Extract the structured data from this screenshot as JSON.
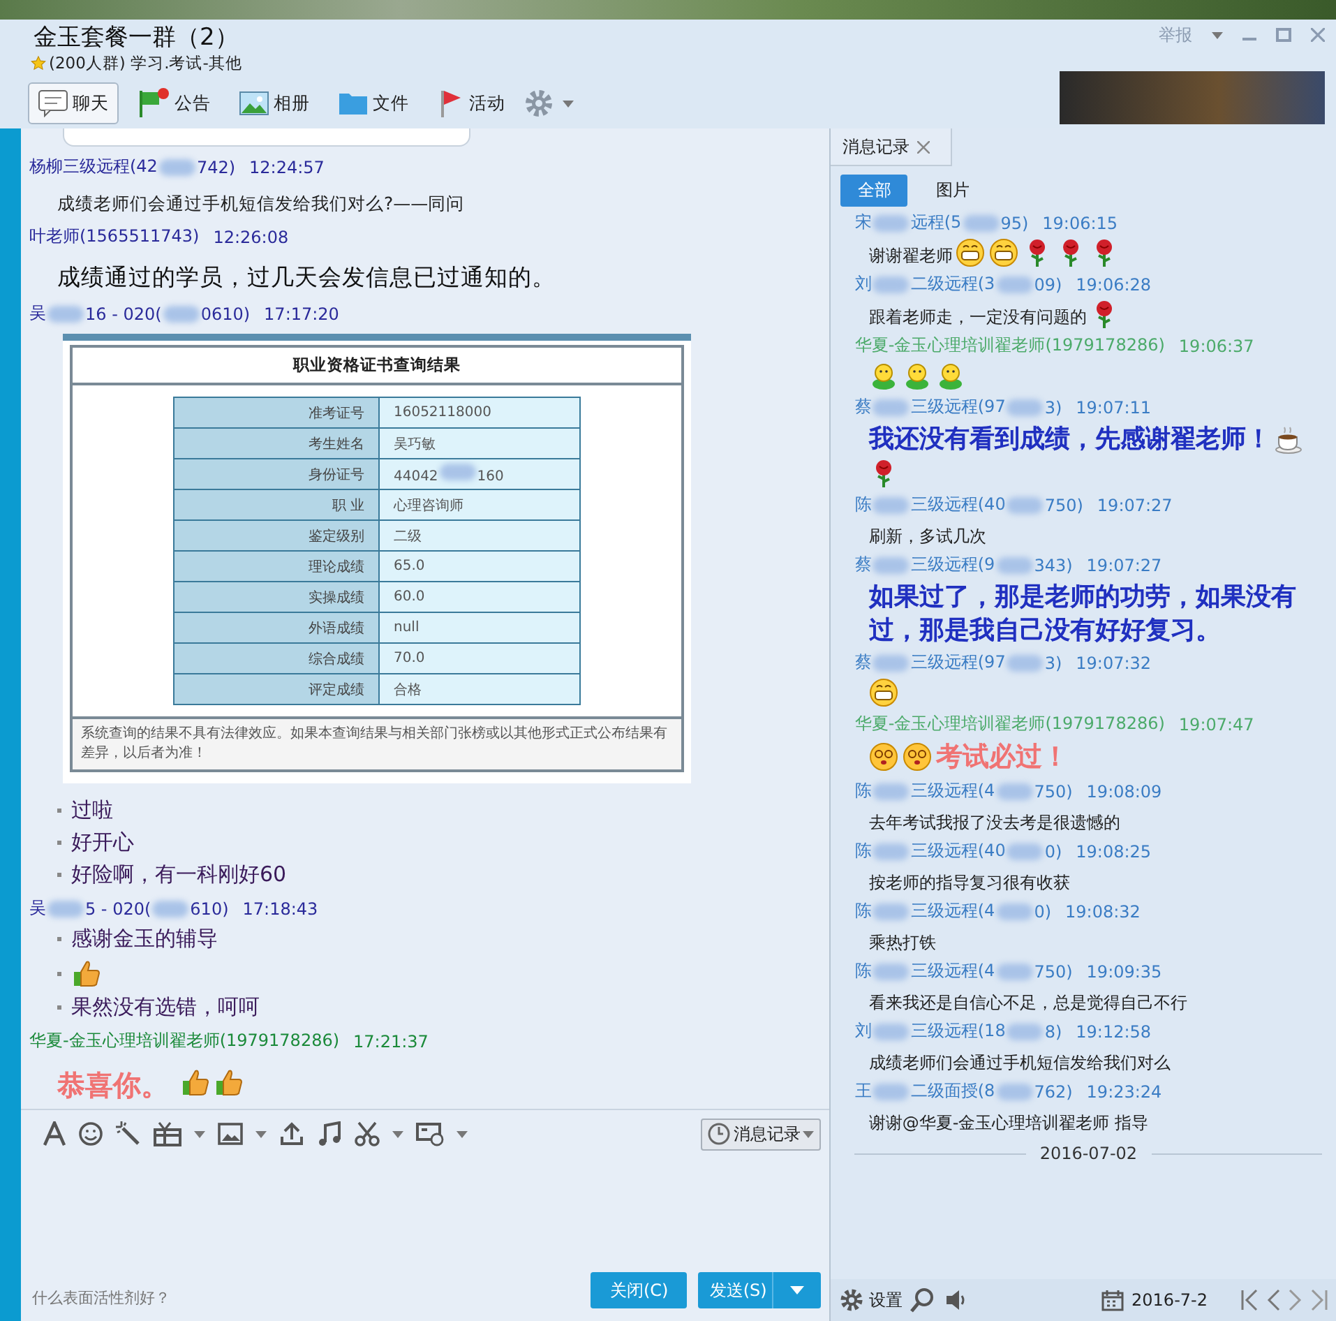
{
  "window": {
    "title": "金玉套餐一群（2）",
    "subtitle": "(200人群) 学习.考试-其他",
    "report": "举报"
  },
  "tabs": [
    {
      "label": "聊天",
      "kind": "chat",
      "selected": true
    },
    {
      "label": "公告",
      "kind": "notice",
      "selected": false
    },
    {
      "label": "相册",
      "kind": "album",
      "selected": false
    },
    {
      "label": "文件",
      "kind": "file",
      "selected": false
    },
    {
      "label": "活动",
      "kind": "event",
      "selected": false
    }
  ],
  "chat": {
    "messages": [
      {
        "sender": [
          "杨柳三级远程(42",
          "742)"
        ],
        "color": "#2a2a9a",
        "time": "12:24:57",
        "kind": "plain",
        "lines": [
          [
            {
              "kind": "text",
              "text": "成绩老师们会通过手机短信发给我们对么?——同问"
            }
          ]
        ]
      },
      {
        "sender": [
          "叶老师(1565511743)"
        ],
        "color": "#2a2a9a",
        "time": "12:26:08",
        "kind": "large",
        "lines": [
          [
            {
              "kind": "text",
              "text": "成绩通过的学员，过几天会发信息已过通知的。"
            }
          ]
        ]
      },
      {
        "sender": [
          "吴",
          "16 - 020(",
          "0610)"
        ],
        "color": "#2a2a9a",
        "time": "17:17:20",
        "kind": "bullet",
        "certificate": {
          "title": "职业资格证书查询结果",
          "rows": [
            {
              "label": "准考证号",
              "value": [
                "16052118000"
              ]
            },
            {
              "label": "考生姓名",
              "value": [
                "吴巧敏"
              ]
            },
            {
              "label": "身份证号",
              "value": [
                "44042",
                "160"
              ]
            },
            {
              "label": "职 业",
              "value": [
                "心理咨询师"
              ]
            },
            {
              "label": "鉴定级别",
              "value": [
                "二级"
              ]
            },
            {
              "label": "理论成绩",
              "value": [
                "65.0"
              ]
            },
            {
              "label": "实操成绩",
              "value": [
                "60.0"
              ]
            },
            {
              "label": "外语成绩",
              "value": [
                "null"
              ]
            },
            {
              "label": "综合成绩",
              "value": [
                "70.0"
              ]
            },
            {
              "label": "评定成绩",
              "value": [
                "合格"
              ]
            }
          ],
          "notice": "系统查询的结果不具有法律效应。如果本查询结果与相关部门张榜或以其他形式正式公布结果有差异，以后者为准！"
        },
        "lines": [
          [
            {
              "kind": "text",
              "text": "过啦"
            }
          ],
          [
            {
              "kind": "text",
              "text": "好开心"
            }
          ],
          [
            {
              "kind": "text",
              "text": "好险啊，有一科刚好60"
            }
          ]
        ]
      },
      {
        "sender": [
          "吴",
          "5 - 020(",
          "610)"
        ],
        "color": "#2a2a9a",
        "time": "17:18:43",
        "kind": "bullet",
        "lines": [
          [
            {
              "kind": "text",
              "text": "感谢金玉的辅导"
            }
          ],
          [
            {
              "kind": "thumb"
            }
          ],
          [
            {
              "kind": "text",
              "text": "果然没有选错，呵呵"
            }
          ]
        ]
      },
      {
        "sender": [
          "华夏-金玉心理培训翟老师(1979178286)"
        ],
        "color": "#1b8a3a",
        "time": "17:21:37",
        "kind": "pink",
        "lines": [
          [
            {
              "kind": "text",
              "text": "恭喜你。"
            },
            {
              "kind": "thumb"
            },
            {
              "kind": "thumb"
            }
          ]
        ]
      }
    ],
    "history_button": "消息记录",
    "hint": "什么表面活性剂好？",
    "close_button": "关闭(C)",
    "send_button": "发送(S)"
  },
  "history": {
    "tab": "消息记录",
    "filters": [
      {
        "label": "全部",
        "selected": true
      },
      {
        "label": "图片",
        "selected": false
      }
    ],
    "messages": [
      {
        "sender": [
          "宋",
          "远程(5",
          "95)"
        ],
        "color": "#3a7cc4",
        "time": "19:06:15",
        "kind": "plain",
        "segments": [
          {
            "kind": "text",
            "text": "谢谢翟老师"
          },
          {
            "kind": "grin"
          },
          {
            "kind": "grin"
          },
          {
            "kind": "rose"
          },
          {
            "kind": "rose"
          },
          {
            "kind": "rose"
          }
        ]
      },
      {
        "sender": [
          "刘",
          "二级远程(3",
          "09)"
        ],
        "color": "#3a7cc4",
        "time": "19:06:28",
        "kind": "plain",
        "segments": [
          {
            "kind": "text",
            "text": "跟着老师走，一定没有问题的"
          },
          {
            "kind": "rose"
          }
        ]
      },
      {
        "sender": [
          "华夏-金玉心理培训翟老师(1979178286)"
        ],
        "color": "#4caa6a",
        "time": "19:06:37",
        "kind": "plain",
        "segments": [
          {
            "kind": "figure"
          },
          {
            "kind": "figure"
          },
          {
            "kind": "figure"
          }
        ]
      },
      {
        "sender": [
          "蔡",
          "三级远程(97",
          "3)"
        ],
        "color": "#3a7cc4",
        "time": "19:07:11",
        "kind": "blue",
        "segments": [
          {
            "kind": "text",
            "text": "我还没有看到成绩，先感谢翟老师！"
          },
          {
            "kind": "coffee"
          },
          {
            "kind": "rose"
          }
        ]
      },
      {
        "sender": [
          "陈",
          "三级远程(40",
          "750)"
        ],
        "color": "#3a7cc4",
        "time": "19:07:27",
        "kind": "plain",
        "segments": [
          {
            "kind": "text",
            "text": "刷新，多试几次"
          }
        ]
      },
      {
        "sender": [
          "蔡",
          "三级远程(9",
          "343)"
        ],
        "color": "#3a7cc4",
        "time": "19:07:27",
        "kind": "blue",
        "segments": [
          {
            "kind": "text",
            "text": "如果过了，那是老师的功劳，如果没有过，那是我自己没有好好复习。"
          }
        ]
      },
      {
        "sender": [
          "蔡",
          "三级远程(97",
          "3)"
        ],
        "color": "#3a7cc4",
        "time": "19:07:32",
        "kind": "plain",
        "segments": [
          {
            "kind": "grin"
          }
        ]
      },
      {
        "sender": [
          "华夏-金玉心理培训翟老师(1979178286)"
        ],
        "color": "#4caa6a",
        "time": "19:07:47",
        "kind": "pink",
        "segments": [
          {
            "kind": "dizzy"
          },
          {
            "kind": "dizzy"
          },
          {
            "kind": "text",
            "text": "考试必过！"
          }
        ]
      },
      {
        "sender": [
          "陈",
          "三级远程(4",
          "750)"
        ],
        "color": "#3a7cc4",
        "time": "19:08:09",
        "kind": "plain",
        "segments": [
          {
            "kind": "text",
            "text": "去年考试我报了没去考是很遗憾的"
          }
        ]
      },
      {
        "sender": [
          "陈",
          "三级远程(40",
          "0)"
        ],
        "color": "#3a7cc4",
        "time": "19:08:25",
        "kind": "plain",
        "segments": [
          {
            "kind": "text",
            "text": "按老师的指导复习很有收获"
          }
        ]
      },
      {
        "sender": [
          "陈",
          "三级远程(4",
          "0)"
        ],
        "color": "#3a7cc4",
        "time": "19:08:32",
        "kind": "plain",
        "segments": [
          {
            "kind": "text",
            "text": "乘热打铁"
          }
        ]
      },
      {
        "sender": [
          "陈",
          "三级远程(4",
          "750)"
        ],
        "color": "#3a7cc4",
        "time": "19:09:35",
        "kind": "plain",
        "segments": [
          {
            "kind": "text",
            "text": "看来我还是自信心不足，总是觉得自己不行"
          }
        ]
      },
      {
        "sender": [
          "刘",
          "三级远程(18",
          "8)"
        ],
        "color": "#3a7cc4",
        "time": "19:12:58",
        "kind": "plain",
        "segments": [
          {
            "kind": "text",
            "text": "成绩老师们会通过手机短信发给我们对么"
          }
        ]
      },
      {
        "sender": [
          "王",
          "二级面授(8",
          "762)"
        ],
        "color": "#3a7cc4",
        "time": "19:23:24",
        "kind": "plain",
        "segments": [
          {
            "kind": "text",
            "text": "谢谢@华夏-金玉心理培训翟老师 指导"
          }
        ]
      }
    ],
    "date_separator": "2016-07-02",
    "settings": "设置",
    "date": "2016-7-2"
  }
}
